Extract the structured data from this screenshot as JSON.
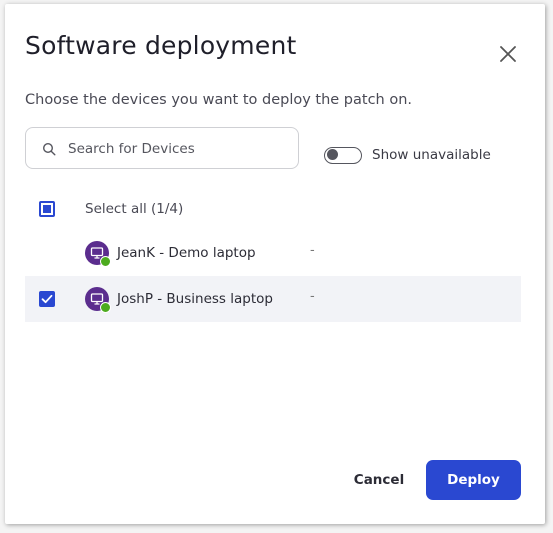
{
  "dialog": {
    "title": "Software deployment",
    "subtitle": "Choose the devices you want to deploy the patch on.",
    "close_icon": "close-icon"
  },
  "search": {
    "placeholder": "Search for Devices",
    "value": "",
    "icon": "search-icon"
  },
  "show_unavailable": {
    "label": "Show unavailable",
    "on": false
  },
  "select_all": {
    "label": "Select all (1/4)",
    "state": "partial"
  },
  "devices": [
    {
      "name": "JeanK - Demo laptop",
      "extra": "-",
      "checked": false,
      "status": "online",
      "icon": "computer-icon"
    },
    {
      "name": "JoshP - Business laptop",
      "extra": "-",
      "checked": true,
      "status": "online",
      "icon": "computer-icon"
    }
  ],
  "actions": {
    "cancel_label": "Cancel",
    "deploy_label": "Deploy"
  },
  "colors": {
    "accent": "#2a48d1",
    "avatar": "#5b2d8e",
    "online": "#4dab1f",
    "selected_row": "#f2f3f7"
  }
}
